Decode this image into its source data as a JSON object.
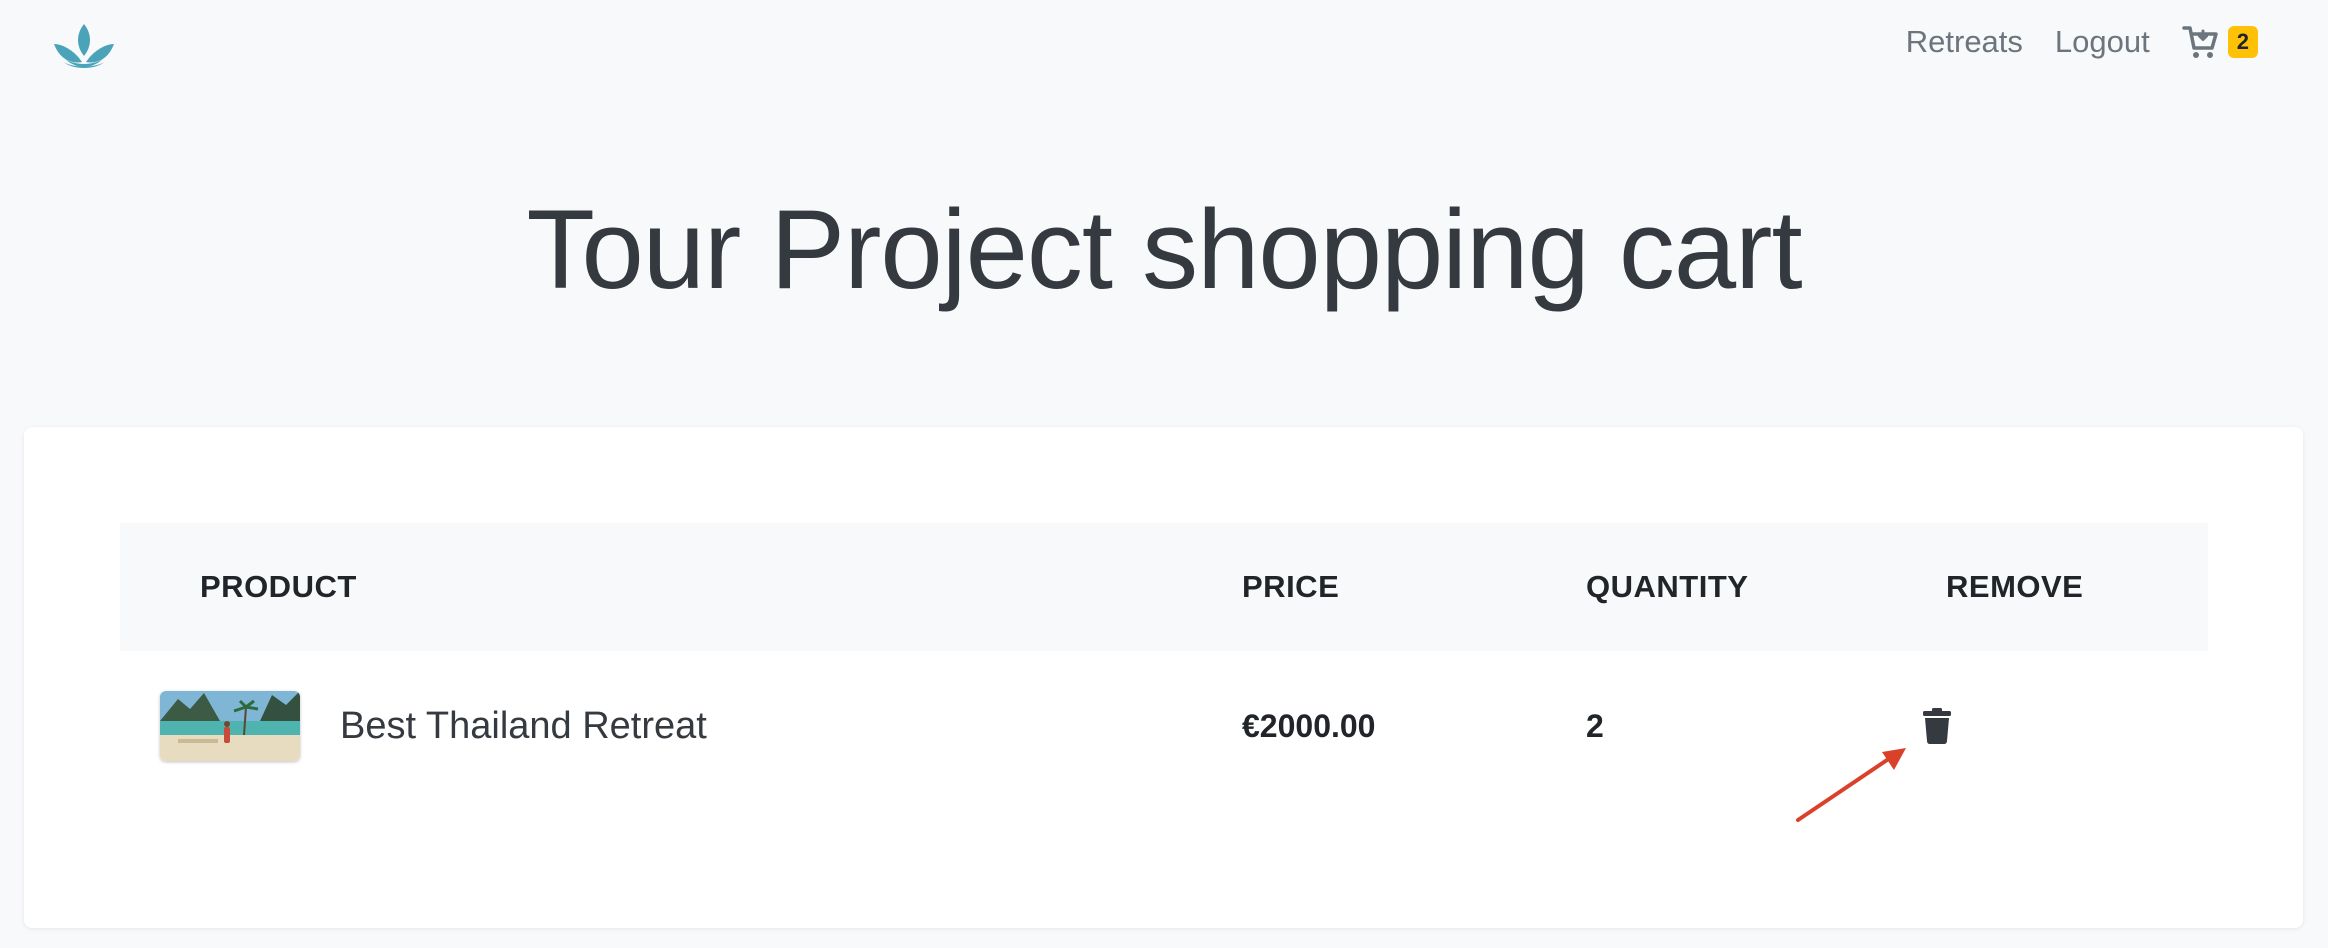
{
  "navbar": {
    "logo_icon": "lotus-logo-icon",
    "links": {
      "retreats": "Retreats",
      "logout": "Logout"
    },
    "cart": {
      "icon": "cart-icon",
      "count": "2",
      "badge_color": "#ffc107"
    }
  },
  "page": {
    "title": "Tour Project shopping cart"
  },
  "cart_table": {
    "headers": {
      "product": "PRODUCT",
      "price": "PRICE",
      "quantity": "QUANTITY",
      "remove": "REMOVE"
    },
    "rows": [
      {
        "product_name": "Best Thailand Retreat",
        "price": "€2000.00",
        "quantity": "2",
        "remove_icon": "trash-icon"
      }
    ]
  },
  "annotation": {
    "arrow_color": "#d9412b"
  },
  "colors": {
    "brand": "#4aa3b8",
    "background": "#f8f9fa",
    "text": "#343a40"
  }
}
